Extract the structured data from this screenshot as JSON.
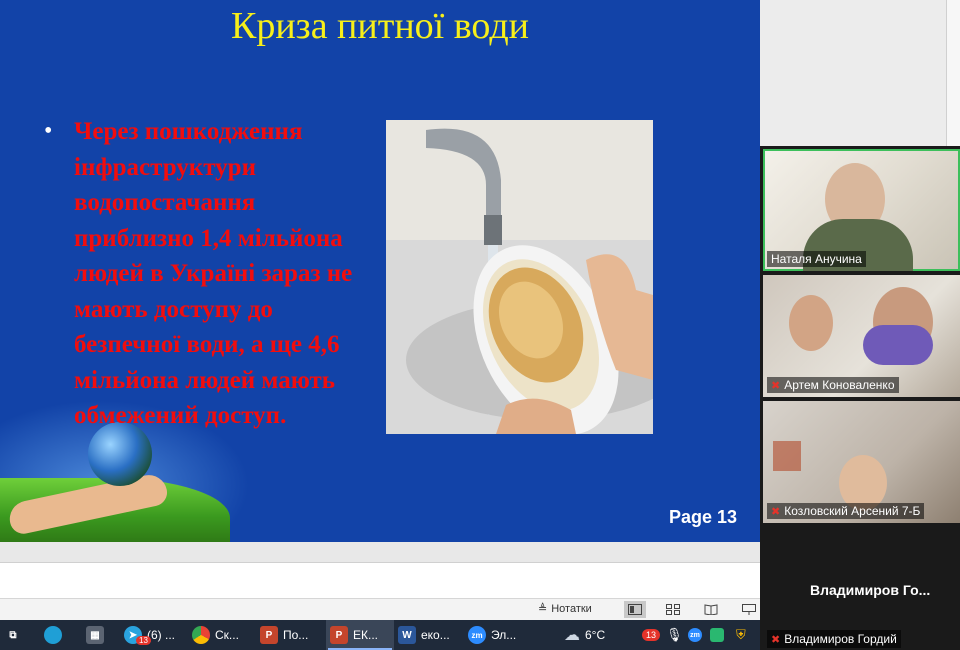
{
  "slide": {
    "title": "Криза питної  води",
    "bullet": "•",
    "body": "Через пошкодження інфраструктури водопостачання приблизно 1,4 мільйона людей в Україні зараз не мають доступу до безпечної води, а ще 4,6 мільйона людей мають обмежений доступ.",
    "page_label": "Page 13",
    "colors": {
      "background": "#1243a8",
      "title": "#f7ef1a",
      "body": "#f20d0d"
    }
  },
  "status_bar": {
    "notes_label": "Нотатки"
  },
  "taskbar": {
    "apps": [
      {
        "icon": "telegram-icon",
        "label": "(6) ...",
        "badge": "13"
      },
      {
        "icon": "chrome-icon",
        "label": "Ск..."
      },
      {
        "icon": "powerpoint-icon",
        "label": "По..."
      },
      {
        "icon": "powerpoint-icon",
        "label": "ЕК..."
      },
      {
        "icon": "word-icon",
        "label": "еко..."
      },
      {
        "icon": "zoom-icon",
        "label": "Эл..."
      }
    ],
    "weather": "6°C",
    "tray_badge": "13"
  },
  "participants": [
    {
      "name": "Наталя Анучина",
      "muted": false
    },
    {
      "name": "Артем Коноваленко",
      "muted": true
    },
    {
      "name": "Козловский Арсений 7-Б",
      "muted": true
    },
    {
      "name": "Владимиров Гордий",
      "muted": true
    }
  ],
  "speaker_big_name": "Владимиров  Го..."
}
